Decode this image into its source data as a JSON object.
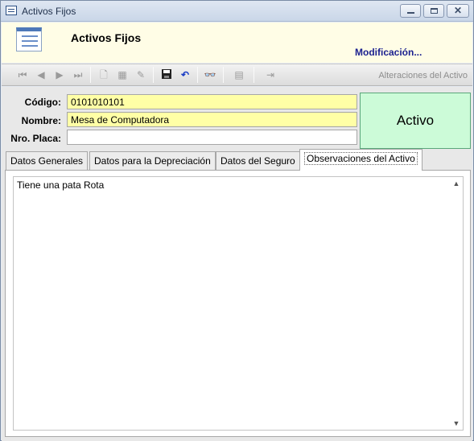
{
  "window": {
    "title": "Activos Fijos"
  },
  "header": {
    "title": "Activos Fijos",
    "mode": "Modificación..."
  },
  "toolbar": {
    "status": "Alteraciones del Activo"
  },
  "form": {
    "codigo_label": "Código:",
    "codigo_value": "0101010101",
    "nombre_label": "Nombre:",
    "nombre_value": "Mesa de Computadora",
    "placa_label": "Nro. Placa:",
    "placa_value": "",
    "status": "Activo"
  },
  "tabs": [
    {
      "label": "Datos Generales"
    },
    {
      "label": "Datos para la Depreciación"
    },
    {
      "label": "Datos del Seguro"
    },
    {
      "label": "Observaciones del Activo"
    }
  ],
  "observaciones": {
    "text": "Tiene una pata Rota"
  }
}
